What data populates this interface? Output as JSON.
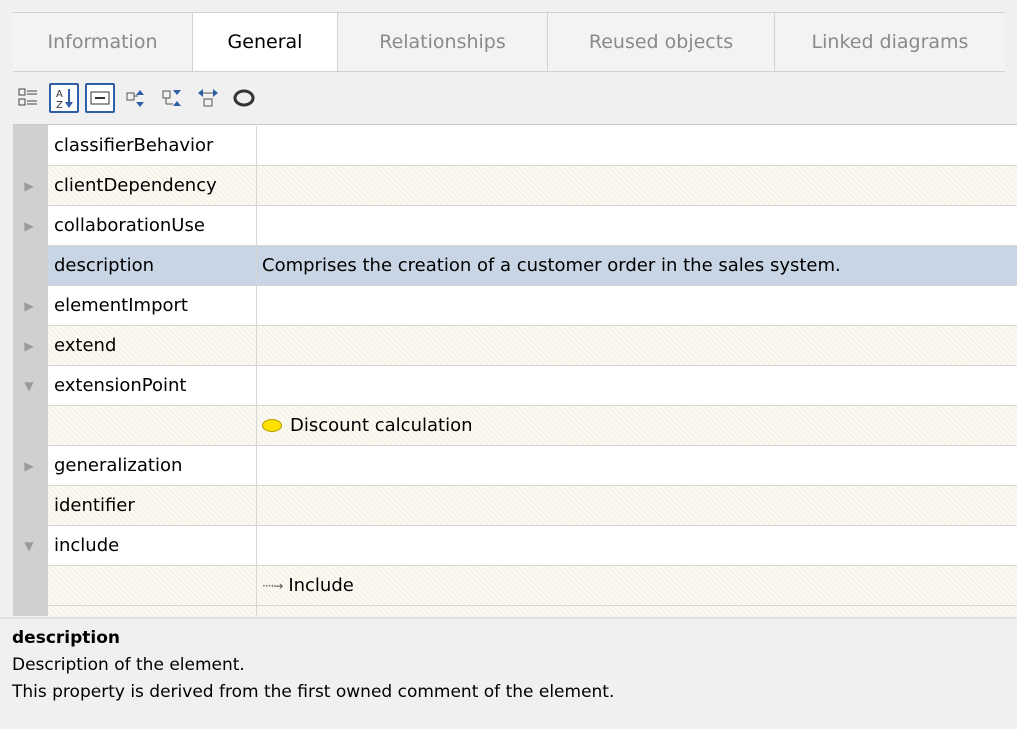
{
  "tabs": [
    {
      "label": "Information",
      "active": false
    },
    {
      "label": "General",
      "active": true
    },
    {
      "label": "Relationships",
      "active": false
    },
    {
      "label": "Reused objects",
      "active": false
    },
    {
      "label": "Linked diagrams",
      "active": false
    }
  ],
  "toolbar": {
    "items": [
      {
        "icon": "categories-icon",
        "pressed": false
      },
      {
        "icon": "sort-alphabetical-icon",
        "pressed": true
      },
      {
        "icon": "show-advanced-icon",
        "pressed": true
      },
      {
        "icon": "expand-all-icon",
        "pressed": false
      },
      {
        "icon": "collapse-all-icon",
        "pressed": false
      },
      {
        "icon": "navigate-icon",
        "pressed": false
      },
      {
        "icon": "eye-icon",
        "pressed": false
      }
    ]
  },
  "properties": [
    {
      "name": "classifierBehavior",
      "value": "",
      "expander": "none",
      "value_icon": ""
    },
    {
      "name": "clientDependency",
      "value": "",
      "expander": "collapsed",
      "value_icon": ""
    },
    {
      "name": "collaborationUse",
      "value": "",
      "expander": "collapsed",
      "value_icon": ""
    },
    {
      "name": "description",
      "value": "Comprises the creation of a customer order in the sales system.",
      "expander": "none",
      "selected": true,
      "value_icon": ""
    },
    {
      "name": "elementImport",
      "value": "",
      "expander": "collapsed",
      "value_icon": ""
    },
    {
      "name": "extend",
      "value": "",
      "expander": "collapsed",
      "value_icon": ""
    },
    {
      "name": "extensionPoint",
      "value": "",
      "expander": "expanded",
      "value_icon": ""
    },
    {
      "name": "",
      "value": "Discount calculation",
      "expander": "none",
      "value_icon": "extension-point-icon"
    },
    {
      "name": "generalization",
      "value": "",
      "expander": "collapsed",
      "value_icon": ""
    },
    {
      "name": "identifier",
      "value": "",
      "expander": "none",
      "value_icon": ""
    },
    {
      "name": "include",
      "value": "",
      "expander": "expanded",
      "value_icon": ""
    },
    {
      "name": "",
      "value": "Include",
      "expander": "none",
      "value_icon": "include-arrow-icon"
    }
  ],
  "description_panel": {
    "title": "description",
    "line1": "Description of the element.",
    "line2": "This property is derived from the first owned comment of the element."
  }
}
